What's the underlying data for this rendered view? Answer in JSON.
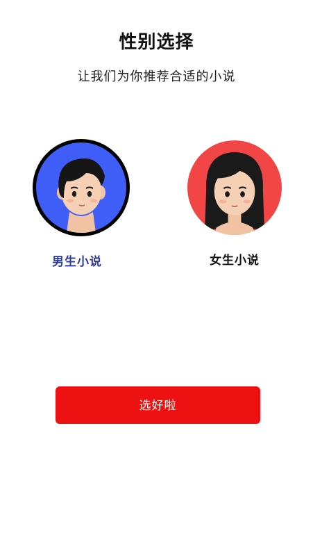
{
  "header": {
    "title": "性别选择",
    "subtitle": "让我们为你推荐合适的小说"
  },
  "options": [
    {
      "label": "男生小说",
      "selected": true,
      "avatar_color": "#3f5ef7",
      "label_color": "#2b3a9c"
    },
    {
      "label": "女生小说",
      "selected": false,
      "avatar_color": "#f24646",
      "label_color": "#111111"
    }
  ],
  "confirm": {
    "label": "选好啦",
    "color": "#ee1111"
  }
}
